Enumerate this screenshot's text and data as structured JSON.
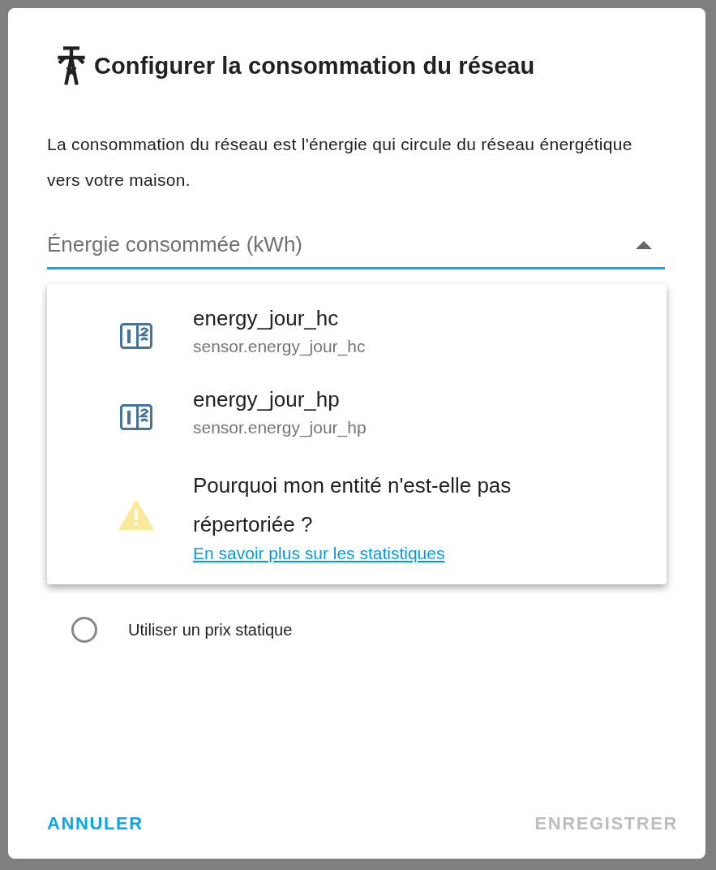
{
  "dialog": {
    "title": "Configurer la consommation du réseau",
    "description": "La consommation du réseau est l'énergie qui circule du réseau énergétique vers votre maison."
  },
  "field": {
    "placeholder": "Énergie consommée (kWh)",
    "expanded": true
  },
  "options": [
    {
      "kind": "entity",
      "name": "energy_jour_hc",
      "entity_id": "sensor.energy_jour_hc"
    },
    {
      "kind": "entity",
      "name": "energy_jour_hp",
      "entity_id": "sensor.energy_jour_hp"
    },
    {
      "kind": "help",
      "text": "Pourquoi mon entité n'est-elle pas répertoriée ?",
      "link": "En savoir plus sur les statistiques"
    }
  ],
  "radio": {
    "label": "Utiliser un prix statique",
    "checked": false
  },
  "buttons": [
    {
      "label": "ANNULER",
      "disabled": false
    },
    {
      "label": "ENREGISTRER",
      "disabled": true
    }
  ]
}
